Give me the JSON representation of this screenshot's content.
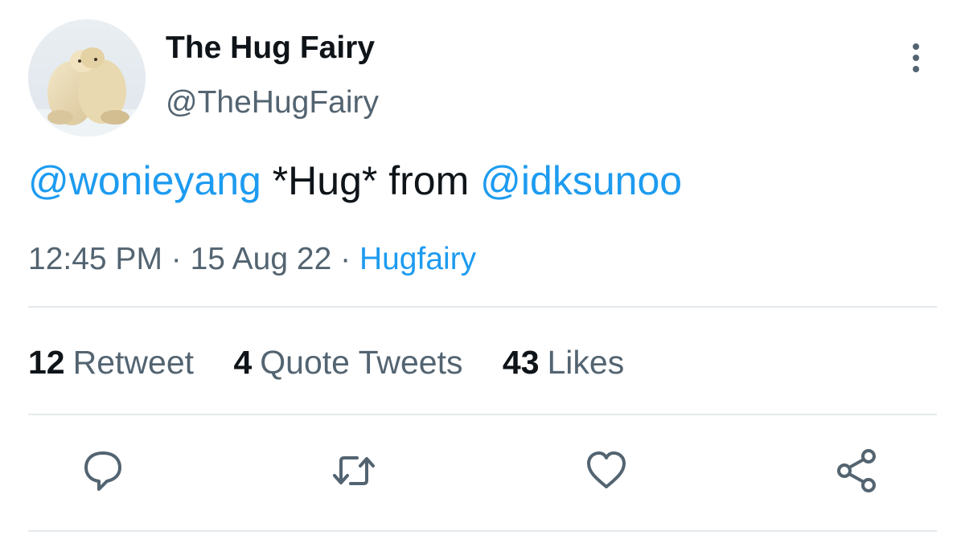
{
  "tweet": {
    "author": {
      "display_name": "The Hug Fairy",
      "handle": "@TheHugFairy"
    },
    "text": {
      "mention_1": "@wonieyang",
      "body": " *Hug* from ",
      "mention_2": "@idksunoo"
    },
    "meta": {
      "time": "12:45 PM",
      "separator": " · ",
      "date": "15 Aug 22",
      "source": "Hugfairy"
    },
    "stats": {
      "retweets_count": "12",
      "retweets_label": "Retweet",
      "quotes_count": "4",
      "quotes_label": "Quote Tweets",
      "likes_count": "43",
      "likes_label": "Likes"
    },
    "actions": {
      "reply_icon": "reply-icon",
      "retweet_icon": "retweet-icon",
      "like_icon": "heart-icon",
      "share_icon": "share-icon"
    }
  },
  "colors": {
    "link": "#1d9bf0",
    "text_primary": "#0f1419",
    "text_secondary": "#536471",
    "divider": "#e5e9ec"
  }
}
